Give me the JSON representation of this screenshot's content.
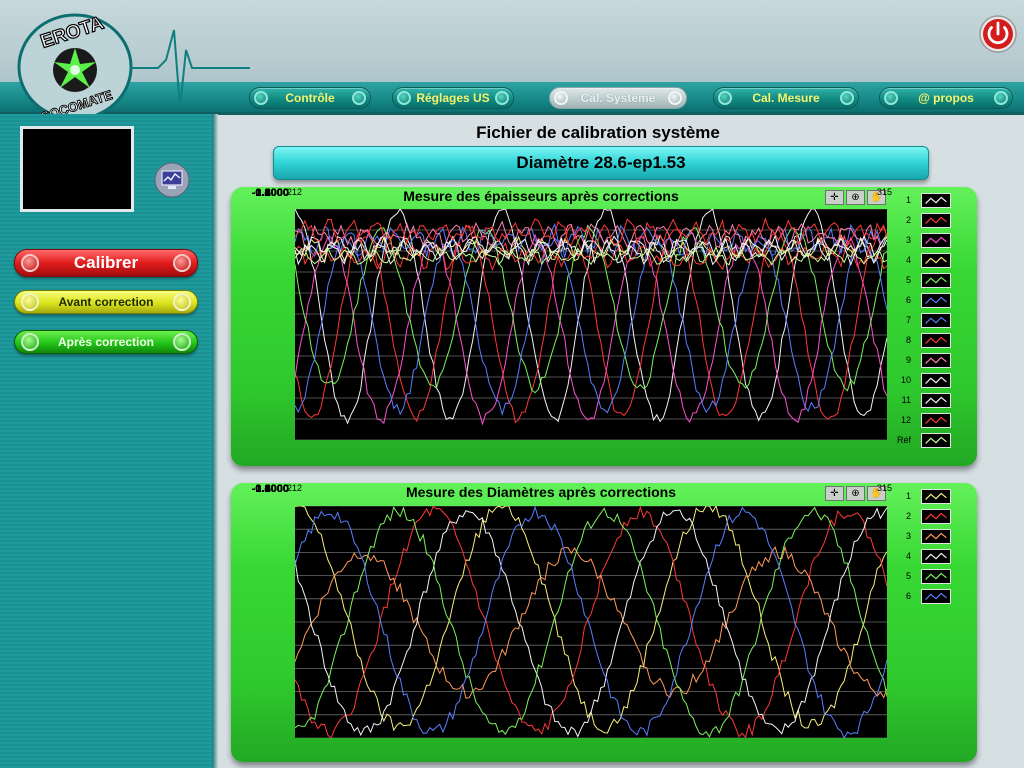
{
  "app": {
    "logo_text_top": "EROTA",
    "logo_text_bottom": "SOCOMATE"
  },
  "tabs": [
    {
      "label": "Contrôle",
      "active": false
    },
    {
      "label": "Réglages US",
      "active": false
    },
    {
      "label": "Cal. Système",
      "active": true
    },
    {
      "label": "Cal. Mesure",
      "active": false
    },
    {
      "label": "@ propos",
      "active": false
    }
  ],
  "sidebar": {
    "calibrer_label": "Calibrer",
    "avant_label": "Avant correction",
    "apres_label": "Après correction"
  },
  "main": {
    "title": "Fichier de calibration système",
    "subtitle": "Diamètre 28.6-ep1.53"
  },
  "colors": {
    "white": "#f4f4f4",
    "red": "#ff3838",
    "magenta": "#ff4fd0",
    "yellow": "#f8f07a",
    "green": "#7cf25c",
    "blue": "#5a7dff",
    "light_green": "#c8ff9a",
    "pink": "#ff80b0",
    "orange": "#ff9a5a"
  },
  "chart_data": [
    {
      "type": "line",
      "title": "Mesure des épaisseurs après corrections",
      "ylim": [
        -1.2,
        1.0
      ],
      "yticks": [
        "1.0000",
        "0.8000",
        "0.6000",
        "0.4000",
        "0.2000",
        "0.0000",
        "-0.2000",
        "-0.4000",
        "-0.6000",
        "-0.8000",
        "-1.0000",
        "-1.2000"
      ],
      "xlim": [
        212,
        315
      ],
      "xticks": [
        "212",
        "315"
      ],
      "grid": true,
      "legend": [
        "1",
        "2",
        "3",
        "4",
        "5",
        "6",
        "7",
        "8",
        "9",
        "10",
        "11",
        "12",
        "Réf"
      ],
      "series": [
        {
          "name": "1",
          "color": "#f4f4f4",
          "kind": "wave",
          "mid": 0.0,
          "amp": 1.0,
          "period": 18,
          "phase": 0
        },
        {
          "name": "2",
          "color": "#ff3838",
          "kind": "wave",
          "mid": -0.1,
          "amp": 0.9,
          "period": 18,
          "phase": 6
        },
        {
          "name": "3",
          "color": "#ff4fd0",
          "kind": "wave",
          "mid": -0.15,
          "amp": 0.85,
          "period": 18,
          "phase": 12
        },
        {
          "name": "4",
          "color": "#f8f07a",
          "kind": "band",
          "mid": 0.62,
          "amp": 0.12
        },
        {
          "name": "5",
          "color": "#7cf25c",
          "kind": "wave",
          "mid": 0.05,
          "amp": 0.75,
          "period": 18,
          "phase": 3
        },
        {
          "name": "6",
          "color": "#5a7dff",
          "kind": "wave",
          "mid": -0.1,
          "amp": 0.8,
          "period": 18,
          "phase": 9
        },
        {
          "name": "7",
          "color": "#5a7dff",
          "kind": "band",
          "mid": 0.7,
          "amp": 0.15
        },
        {
          "name": "8",
          "color": "#ff3838",
          "kind": "band",
          "mid": 0.55,
          "amp": 0.12
        },
        {
          "name": "9",
          "color": "#ff80b0",
          "kind": "band",
          "mid": 0.75,
          "amp": 0.12
        },
        {
          "name": "10",
          "color": "#f4f4f4",
          "kind": "band",
          "mid": 0.65,
          "amp": 0.1
        },
        {
          "name": "11",
          "color": "#f4f4f4",
          "kind": "band",
          "mid": 0.6,
          "amp": 0.12
        },
        {
          "name": "12",
          "color": "#ff3838",
          "kind": "band",
          "mid": 0.78,
          "amp": 0.12
        },
        {
          "name": "Réf",
          "color": "#c8ff9a",
          "kind": "band",
          "mid": 0.55,
          "amp": 0.08
        }
      ]
    },
    {
      "type": "line",
      "title": "Mesure des Diamètres après corrections",
      "ylim": [
        -1.0,
        1.0
      ],
      "yticks": [
        "1.0000",
        "0.8000",
        "0.6000",
        "0.4000",
        "0.2000",
        "0.0000",
        "-0.2000",
        "-0.4000",
        "-0.6000",
        "-0.8000",
        "-1.0000"
      ],
      "xlim": [
        212,
        315
      ],
      "xticks": [
        "212",
        "315"
      ],
      "grid": true,
      "legend": [
        "1",
        "2",
        "3",
        "4",
        "5",
        "6"
      ],
      "series": [
        {
          "name": "1",
          "color": "#f8f07a",
          "kind": "wave",
          "mid": 0.05,
          "amp": 0.95,
          "period": 36,
          "phase": 0
        },
        {
          "name": "2",
          "color": "#ff3838",
          "kind": "wave",
          "mid": 0.0,
          "amp": 0.95,
          "period": 36,
          "phase": 12
        },
        {
          "name": "3",
          "color": "#ff9a5a",
          "kind": "wave",
          "mid": 0.0,
          "amp": 0.6,
          "period": 36,
          "phase": 24
        },
        {
          "name": "4",
          "color": "#f4f4f4",
          "kind": "wave",
          "mid": 0.0,
          "amp": 0.95,
          "period": 36,
          "phase": 6
        },
        {
          "name": "5",
          "color": "#7cf25c",
          "kind": "wave",
          "mid": 0.0,
          "amp": 0.95,
          "period": 36,
          "phase": 18
        },
        {
          "name": "6",
          "color": "#5a7dff",
          "kind": "wave",
          "mid": 0.0,
          "amp": 0.95,
          "period": 36,
          "phase": 30
        }
      ]
    }
  ]
}
